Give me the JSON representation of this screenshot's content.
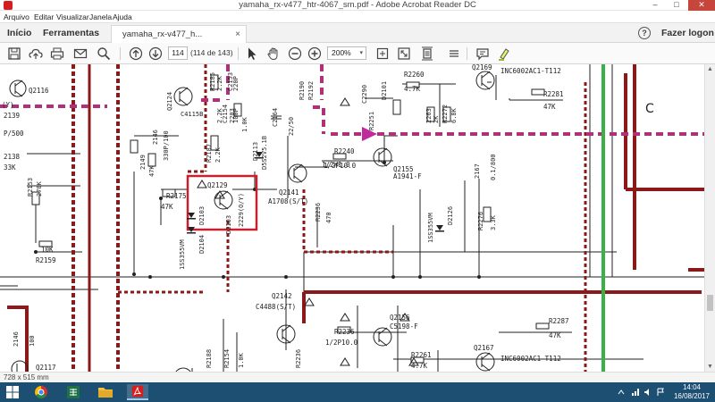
{
  "window": {
    "title": "yamaha_rx-v477_htr-4067_sm.pdf - Adobe Acrobat Reader DC",
    "minimize": "–",
    "maximize": "□",
    "close": "✕"
  },
  "menu": [
    "Arquivo",
    "Editar",
    "Visualizar",
    "Janela",
    "Ajuda"
  ],
  "tabs": {
    "home": "Início",
    "tools": "Ferramentas",
    "document": "yamaha_rx-v477_h...",
    "document_close": "×",
    "help": "?",
    "logon": "Fazer logon"
  },
  "toolbar": {
    "page_number": "114",
    "page_of": "(114 de 143)",
    "zoom": "200%",
    "zoom_caret": "▾"
  },
  "status": {
    "page_size": "728 x 515 mm"
  },
  "clock": {
    "time": "14:04",
    "date": "16/08/2017"
  },
  "colors": {
    "accent_red": "#c7202f",
    "schematic_dark_red": "#8a1a1a",
    "schematic_magenta": "#b0307a",
    "schematic_green": "#3ab04a",
    "taskbar": "#1d4f73"
  },
  "icons": [
    "save-icon",
    "upload-icon",
    "print-icon",
    "email-icon",
    "search-icon",
    "page-up-icon",
    "page-down-icon",
    "select-cursor-icon",
    "hand-icon",
    "zoom-out-icon",
    "zoom-in-icon",
    "fit-page-icon",
    "fullscreen-icon",
    "scroll-mode-icon",
    "comment-icon",
    "highlight-icon"
  ],
  "schematic": {
    "labels": [
      "(Y)",
      "Q2116",
      "2139",
      "P/500",
      "2138",
      "33K",
      "R2153",
      "270K",
      "10K",
      "R2159",
      "2146",
      "100",
      "Q2117",
      "Q2124",
      "C4115B",
      "2146",
      "330P/100",
      "2149",
      "47K",
      "R2175",
      "47K",
      "D2103",
      "1SS355VM",
      "D2104",
      "Q2129",
      "2229(O/Y)",
      "D2103",
      "R2185",
      "2.2K",
      "C2153",
      "220P",
      "2.2K",
      "2203",
      "R2187",
      "C2154",
      "100P",
      "2.2K",
      "1.0K",
      "D2113",
      "D5S2V5.1B",
      "C2164",
      "22/50",
      "R2190",
      "R2192",
      "1/2W1.0",
      "Q2141",
      "A1708(S/T)",
      "R2236",
      "470",
      "R2251",
      "R2240",
      "1/2P10.0",
      "Q2155",
      "A1941-F",
      "R2260",
      "4.7K",
      "2263",
      "2K",
      "R2272",
      "6.8K",
      "Q2169",
      "INC6002AC1-T112",
      "R2281",
      "47K",
      "C",
      "2167",
      "0.1/800",
      "D2126",
      "1SS355VM",
      "R2276",
      "3.3K",
      "C2290",
      "D2101",
      "Q2142",
      "C4488(S/T)",
      "R2236",
      "1/2P10.0",
      "Q2156",
      "C5198-F",
      "R2261",
      "4.7K",
      "R2287",
      "47K",
      "Q2167",
      "INC6002AC1-T112",
      "R2188",
      "R2154",
      "R2236",
      "1.0K"
    ]
  }
}
